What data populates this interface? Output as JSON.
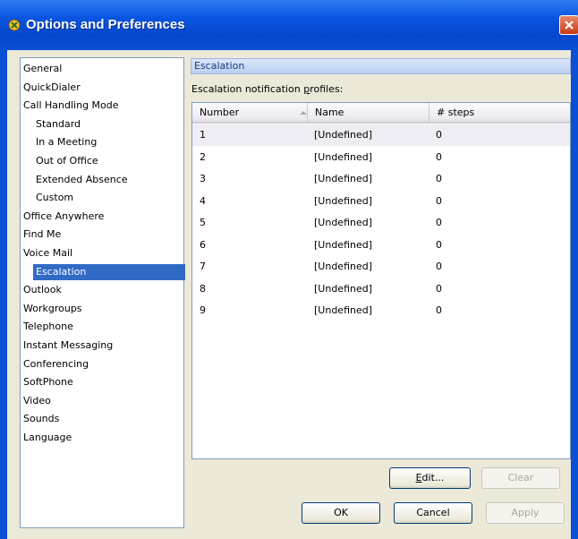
{
  "window": {
    "title": "Options and Preferences"
  },
  "tree": {
    "items": [
      {
        "label": "General",
        "indent": 0
      },
      {
        "label": "QuickDialer",
        "indent": 0
      },
      {
        "label": "Call Handling Mode",
        "indent": 0
      },
      {
        "label": "Standard",
        "indent": 1
      },
      {
        "label": "In a Meeting",
        "indent": 1
      },
      {
        "label": "Out of Office",
        "indent": 1
      },
      {
        "label": "Extended Absence",
        "indent": 1
      },
      {
        "label": "Custom",
        "indent": 1
      },
      {
        "label": "Office Anywhere",
        "indent": 0
      },
      {
        "label": "Find Me",
        "indent": 0
      },
      {
        "label": "Voice Mail",
        "indent": 0
      },
      {
        "label": "Escalation",
        "indent": 1,
        "selected": true
      },
      {
        "label": "Outlook",
        "indent": 0
      },
      {
        "label": "Workgroups",
        "indent": 0
      },
      {
        "label": "Telephone",
        "indent": 0
      },
      {
        "label": "Instant Messaging",
        "indent": 0
      },
      {
        "label": "Conferencing",
        "indent": 0
      },
      {
        "label": "SoftPhone",
        "indent": 0
      },
      {
        "label": "Video",
        "indent": 0
      },
      {
        "label": "Sounds",
        "indent": 0
      },
      {
        "label": "Language",
        "indent": 0
      }
    ]
  },
  "panel": {
    "header": "Escalation",
    "profiles_label_pre": "Escalation notification ",
    "profiles_label_ul": "p",
    "profiles_label_post": "rofiles:",
    "columns": [
      "Number",
      "Name",
      "# steps"
    ],
    "rows": [
      [
        "1",
        "[Undefined]",
        "0"
      ],
      [
        "2",
        "[Undefined]",
        "0"
      ],
      [
        "3",
        "[Undefined]",
        "0"
      ],
      [
        "4",
        "[Undefined]",
        "0"
      ],
      [
        "5",
        "[Undefined]",
        "0"
      ],
      [
        "6",
        "[Undefined]",
        "0"
      ],
      [
        "7",
        "[Undefined]",
        "0"
      ],
      [
        "8",
        "[Undefined]",
        "0"
      ],
      [
        "9",
        "[Undefined]",
        "0"
      ]
    ]
  },
  "buttons": {
    "edit_pre": "",
    "edit_ul": "E",
    "edit_post": "dit...",
    "clear": "Clear",
    "ok": "OK",
    "cancel": "Cancel",
    "apply": "Apply"
  },
  "colors": {
    "title_bar": "#0a4fd4",
    "selection": "#316ac5",
    "close_button": "#c73a14"
  }
}
